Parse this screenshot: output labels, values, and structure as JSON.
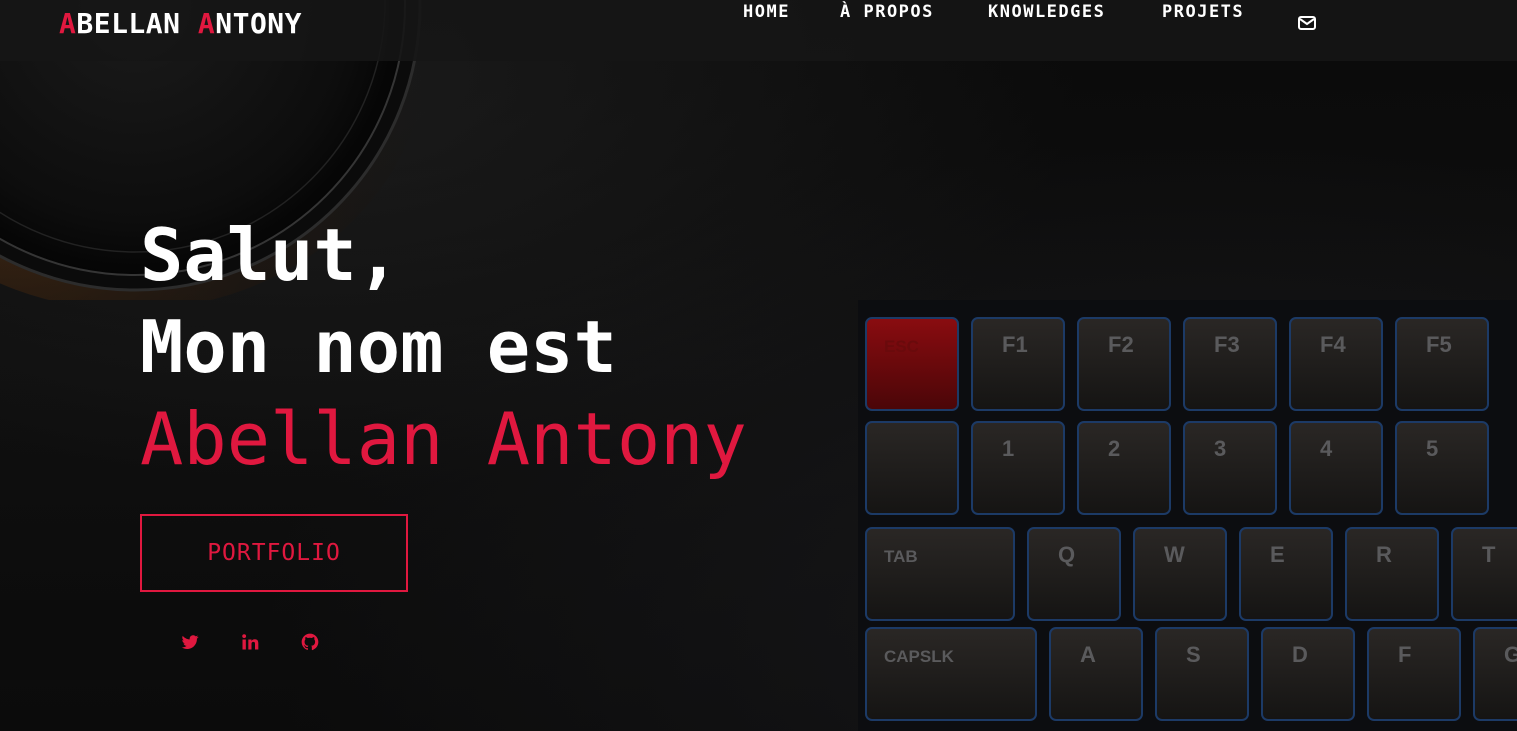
{
  "brand": {
    "first_initial": "A",
    "first_rest": "BELLAN",
    "last_initial": "A",
    "last_rest": "NTONY"
  },
  "nav": {
    "items": [
      {
        "label": "HOME"
      },
      {
        "label": "À PROPOS"
      },
      {
        "label": "KNOWLEDGES"
      },
      {
        "label": "PROJETS"
      }
    ],
    "mail_icon": "mail-icon"
  },
  "hero": {
    "line1": "Salut,",
    "line2": "Mon nom est",
    "name": "Abellan Antony",
    "cta_label": "PORTFOLIO"
  },
  "social": [
    {
      "icon": "twitter-icon"
    },
    {
      "icon": "linkedin-icon"
    },
    {
      "icon": "github-icon"
    }
  ],
  "keyboard_keys": {
    "row1": [
      "ESC",
      "F1",
      "F2",
      "F3",
      "F4",
      "F5"
    ],
    "row2": [
      "1",
      "2",
      "3",
      "4",
      "5"
    ],
    "row3": [
      "TAB",
      "Q",
      "W",
      "E",
      "R",
      "T"
    ],
    "row4": [
      "CAPSLK",
      "A",
      "S",
      "D",
      "F",
      "G"
    ]
  },
  "colors": {
    "accent": "#e0183f",
    "text": "#ffffff",
    "background": "#0b0b0b",
    "navbar": "#161616"
  }
}
